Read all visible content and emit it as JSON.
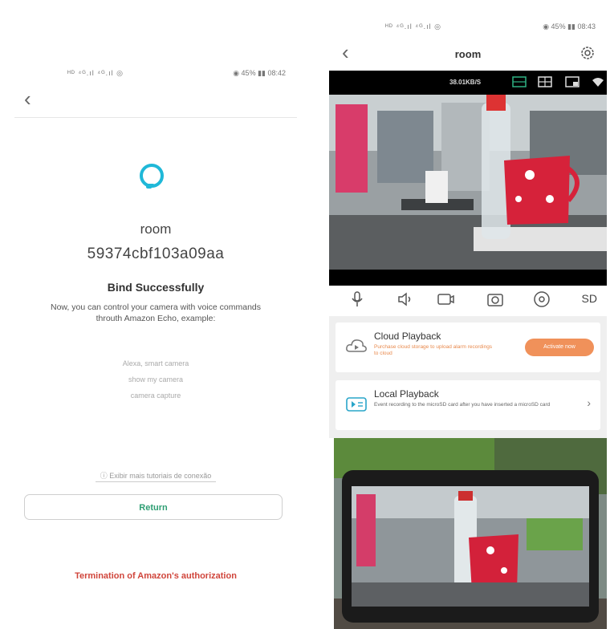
{
  "left": {
    "status_left": "ᴴᴰ ⁴ᴳ.ıl ⁴ᴳ.ıl ◎",
    "status_right": "◉ 45% ▮▮ 08:42",
    "device_name": "room",
    "device_id": "59374cbf103a09aa",
    "bind_title": "Bind Successfully",
    "bind_description": "Now, you can control your camera with voice commands throuth Amazon Echo, example:",
    "commands": [
      "Alexa, smart camera",
      "show my camera",
      "camera capture"
    ],
    "tutorial_link": "Exibir mais tutoriais de conexão",
    "return_label": "Return",
    "terminate_label": "Termination of Amazon's authorization"
  },
  "right": {
    "status_left": "ᴴᴰ ⁴ᴳ.ıl ⁴ᴳ.ıl ◎",
    "status_right": "◉ 45% ▮▮ 08:43",
    "title": "room",
    "bitrate": "38.01KB/S",
    "sd_label": "SD",
    "cloud": {
      "title": "Cloud Playback",
      "subtitle": "Purchase cloud storage to upload alarm recordings to cloud",
      "button": "Activate now"
    },
    "local": {
      "title": "Local Playback",
      "subtitle": "Event recording to the microSD card after you have inserted a microSD card",
      "chevron": "›"
    }
  },
  "colors": {
    "alexa": "#1fb8d8",
    "return_text": "#2e9e73",
    "terminate_text": "#d0453b",
    "activate_button": "#f0915a"
  }
}
